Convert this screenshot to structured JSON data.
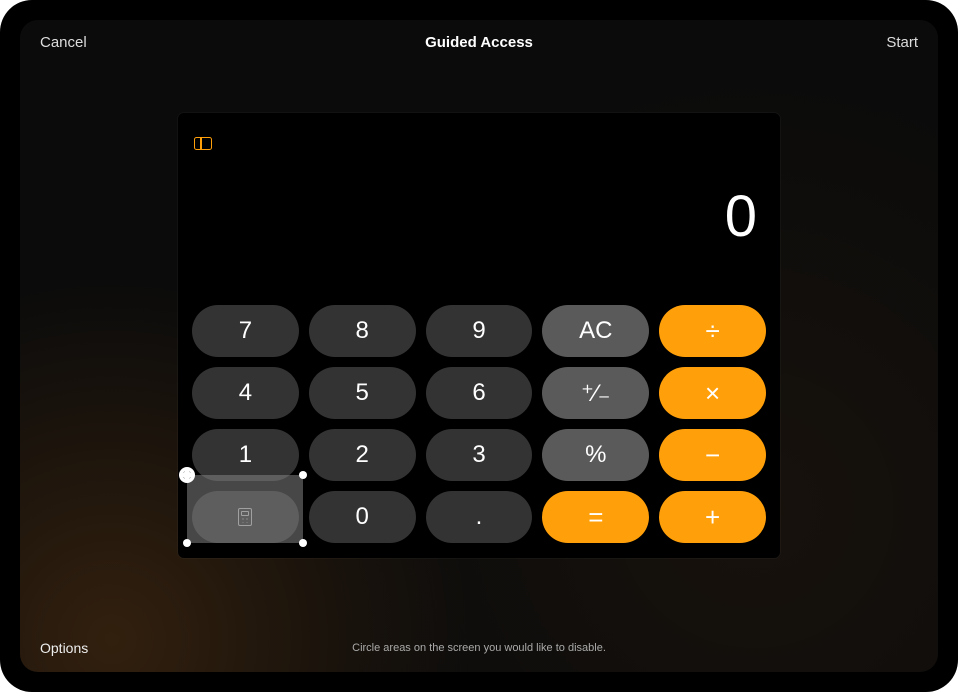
{
  "navbar": {
    "cancel": "Cancel",
    "title": "Guided Access",
    "start": "Start"
  },
  "calculator": {
    "display": "0",
    "sidebar_icon": "sidebar-icon",
    "keys": {
      "r0": [
        "7",
        "8",
        "9",
        "AC",
        "÷"
      ],
      "r1": [
        "4",
        "5",
        "6",
        "⁺∕₋",
        "×"
      ],
      "r2": [
        "1",
        "2",
        "3",
        "%",
        "−"
      ],
      "r3_calc_icon": "calculator-icon",
      "r3": [
        "0",
        ".",
        "=",
        "+"
      ]
    }
  },
  "mask": {
    "close_glyph": "✕"
  },
  "footer": {
    "options": "Options",
    "hint": "Circle areas on the screen you would like to disable."
  },
  "colors": {
    "accent": "#ff9f0a",
    "key_dark": "#333333",
    "key_gray": "#5a5a5a"
  }
}
